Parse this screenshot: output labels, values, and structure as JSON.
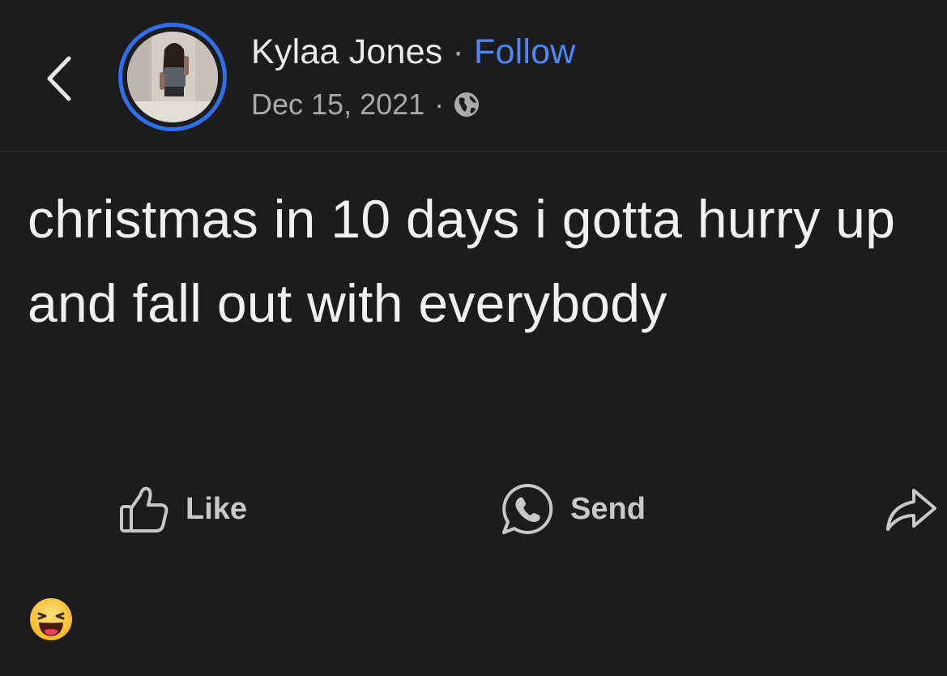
{
  "header": {
    "author_name": "Kylaa Jones",
    "separator": "·",
    "follow_label": "Follow",
    "date": "Dec 15, 2021",
    "meta_separator": "·",
    "back_icon": "chevron-left-icon",
    "privacy_icon": "globe-icon"
  },
  "post": {
    "text": "christmas in 10 days i gotta hurry up and fall out with everybody"
  },
  "actions": {
    "like_label": "Like",
    "send_label": "Send",
    "share_icon": "share-arrow-icon"
  },
  "reactions": {
    "icon": "haha-emoji-icon"
  },
  "colors": {
    "background": "#1c1c1e",
    "accent": "#4f88f0",
    "avatar_ring": "#2f6fe8",
    "text_primary": "#f1f1f1",
    "text_secondary": "#a9a9ab"
  }
}
